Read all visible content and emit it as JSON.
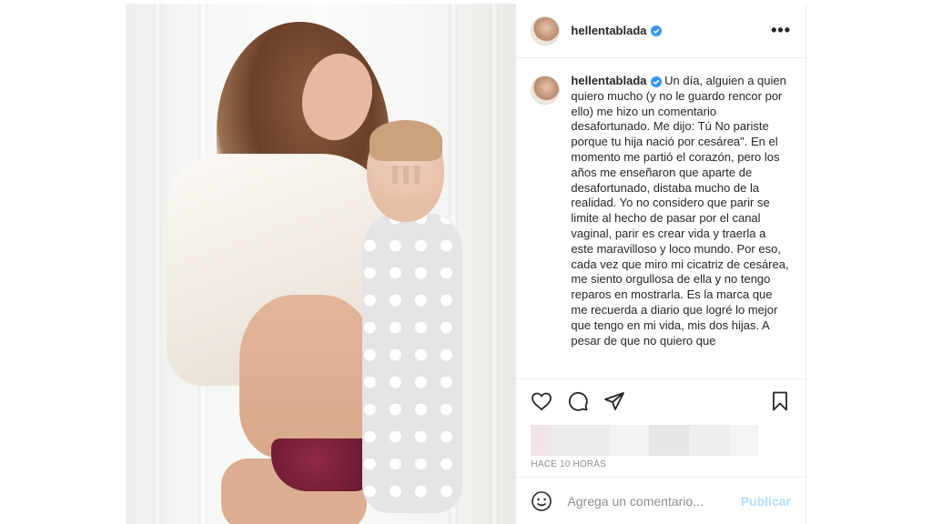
{
  "post": {
    "username": "hellentablada",
    "caption": "Un día, alguien a quien quiero mucho (y no le guardo rencor por ello) me hizo un comentario desafortunado. Me dijo: Tú No pariste porque tu hija nació por cesárea\". En el momento me partió el corazón, pero los años me enseñaron que aparte de desafortunado, distaba mucho de la realidad. Yo no considero que parir se limite al hecho de pasar por el canal vaginal, parir es crear vida y traerla a este maravilloso y loco mundo. Por eso, cada vez que miro mi cicatriz de cesárea, me siento orgullosa de ella y no tengo reparos en mostrarla. Es la marca que me recuerda a diario que logré lo mejor que tengo en mi vida, mis dos hijas. A pesar de que no quiero que",
    "timestamp": "HACE 10 HORAS"
  },
  "icons": {
    "verified": "verified-badge-icon",
    "more": "more-options-icon",
    "like": "heart-icon",
    "comment": "comment-bubble-icon",
    "share": "paper-plane-icon",
    "save": "bookmark-icon",
    "emoji": "emoji-smiley-icon"
  },
  "comment_box": {
    "placeholder": "Agrega un comentario...",
    "publish_label": "Publicar"
  },
  "colors": {
    "verified": "#3897f0",
    "publish_disabled": "#b2dffc",
    "muted_text": "#8e8e8e"
  }
}
